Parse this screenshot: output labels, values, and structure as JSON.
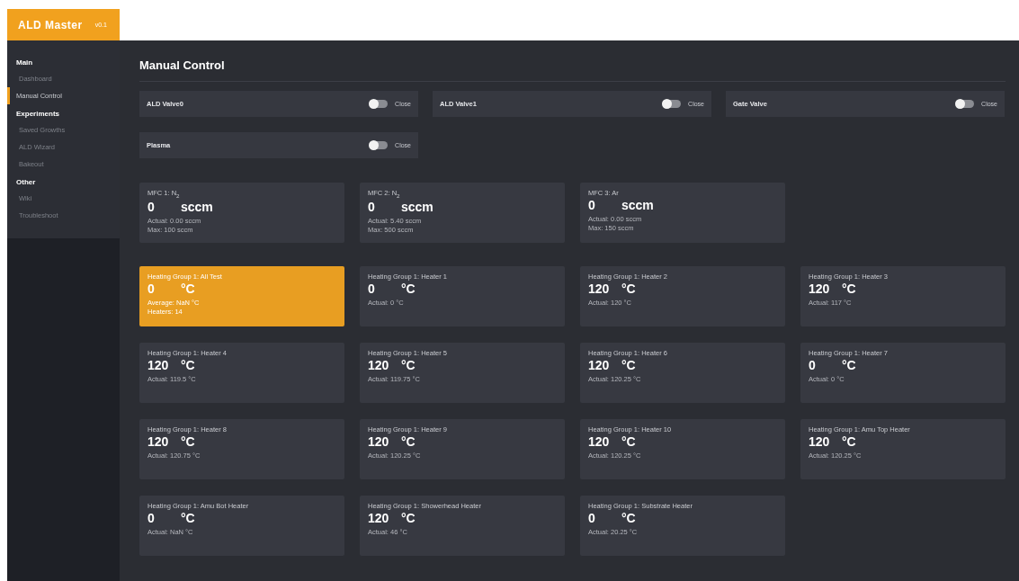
{
  "app": {
    "name": "ALD Master",
    "version": "v0.1"
  },
  "sidebar": {
    "groups": [
      {
        "title": "Main",
        "items": [
          {
            "label": "Dashboard",
            "selected": false
          },
          {
            "label": "Manual Control",
            "selected": true
          }
        ]
      },
      {
        "title": "Experiments",
        "items": [
          {
            "label": "Saved Growths",
            "selected": false
          },
          {
            "label": "ALD Wizard",
            "selected": false
          },
          {
            "label": "Bakeout",
            "selected": false
          }
        ]
      },
      {
        "title": "Other",
        "items": [
          {
            "label": "Wiki",
            "selected": false
          },
          {
            "label": "Troubleshoot",
            "selected": false
          }
        ]
      }
    ]
  },
  "page_title": "Manual Control",
  "valves": [
    {
      "name": "ALD Valve0",
      "on": false,
      "state": "Close"
    },
    {
      "name": "ALD Valve1",
      "on": false,
      "state": "Close"
    },
    {
      "name": "Gate Valve",
      "on": false,
      "state": "Close"
    },
    {
      "name": "Plasma",
      "on": false,
      "state": "Close"
    }
  ],
  "mfcs": [
    {
      "name": "MFC 1: N$_{2}$",
      "value": "0",
      "unit": "sccm",
      "details": [
        "Actual: 0.00 sccm",
        "Max: 100 sccm"
      ]
    },
    {
      "name": "MFC 2: N$_{2}$",
      "value": "0",
      "unit": "sccm",
      "details": [
        "Actual: 5.40 sccm",
        "Max: 500 sccm"
      ]
    },
    {
      "name": "MFC 3: Ar",
      "value": "0",
      "unit": "sccm",
      "details": [
        "Actual: 0.00 sccm",
        "Max: 150 sccm"
      ]
    }
  ],
  "heaters": [
    {
      "name": "Heating Group 1: All Test",
      "value": "0",
      "unit": "°C",
      "selected": true,
      "details": [
        "Average: NaN °C",
        "Heaters: 14"
      ]
    },
    {
      "name": "Heating Group 1: Heater 1",
      "value": "0",
      "unit": "°C",
      "selected": false,
      "details": [
        "Actual: 0 °C"
      ]
    },
    {
      "name": "Heating Group 1: Heater 2",
      "value": "120",
      "unit": "°C",
      "selected": false,
      "details": [
        "Actual: 120 °C"
      ]
    },
    {
      "name": "Heating Group 1: Heater 3",
      "value": "120",
      "unit": "°C",
      "selected": false,
      "details": [
        "Actual: 117 °C"
      ]
    },
    {
      "name": "Heating Group 1: Heater 4",
      "value": "120",
      "unit": "°C",
      "selected": false,
      "details": [
        "Actual: 119.5 °C"
      ]
    },
    {
      "name": "Heating Group 1: Heater 5",
      "value": "120",
      "unit": "°C",
      "selected": false,
      "details": [
        "Actual: 119.75 °C"
      ]
    },
    {
      "name": "Heating Group 1: Heater 6",
      "value": "120",
      "unit": "°C",
      "selected": false,
      "details": [
        "Actual: 120.25 °C"
      ]
    },
    {
      "name": "Heating Group 1: Heater 7",
      "value": "0",
      "unit": "°C",
      "selected": false,
      "details": [
        "Actual: 0 °C"
      ]
    },
    {
      "name": "Heating Group 1: Heater 8",
      "value": "120",
      "unit": "°C",
      "selected": false,
      "details": [
        "Actual: 120.75 °C"
      ]
    },
    {
      "name": "Heating Group 1: Heater 9",
      "value": "120",
      "unit": "°C",
      "selected": false,
      "details": [
        "Actual: 120.25 °C"
      ]
    },
    {
      "name": "Heating Group 1: Heater 10",
      "value": "120",
      "unit": "°C",
      "selected": false,
      "details": [
        "Actual: 120.25 °C"
      ]
    },
    {
      "name": "Heating Group 1: Amu Top Heater",
      "value": "120",
      "unit": "°C",
      "selected": false,
      "details": [
        "Actual: 120.25 °C"
      ]
    },
    {
      "name": "Heating Group 1: Amu Bot Heater",
      "value": "0",
      "unit": "°C",
      "selected": false,
      "details": [
        "Actual: NaN °C"
      ]
    },
    {
      "name": "Heating Group 1: Showerhead Heater",
      "value": "120",
      "unit": "°C",
      "selected": false,
      "details": [
        "Actual: 46 °C"
      ]
    },
    {
      "name": "Heating Group 1: Substrate Heater",
      "value": "0",
      "unit": "°C",
      "selected": false,
      "details": [
        "Actual: 20.25 °C"
      ]
    }
  ]
}
